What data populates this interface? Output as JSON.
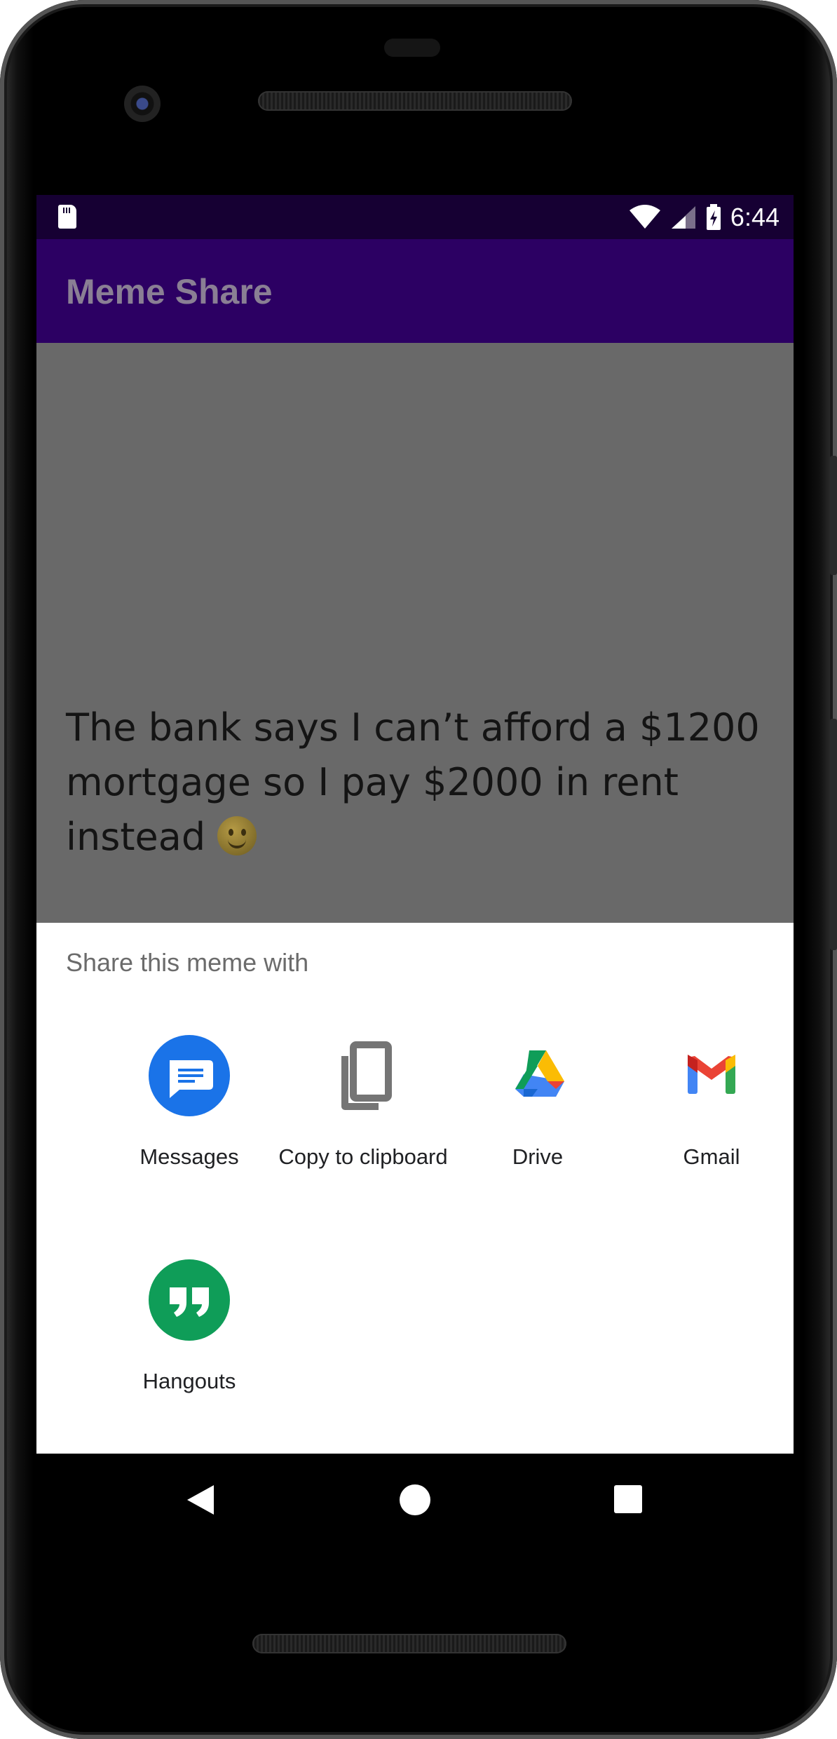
{
  "status_bar": {
    "time": "6:44"
  },
  "app_bar": {
    "title": "Meme Share"
  },
  "meme": {
    "text": "The bank says I can’t afford a $1200 mortgage so I pay $2000 in rent instead"
  },
  "share_sheet": {
    "title": "Share this meme with",
    "targets": [
      {
        "label": "Messages",
        "icon": "messages-icon"
      },
      {
        "label": "Copy to clipboard",
        "icon": "copy-icon"
      },
      {
        "label": "Drive",
        "icon": "drive-icon"
      },
      {
        "label": "Gmail",
        "icon": "gmail-icon"
      },
      {
        "label": "Hangouts",
        "icon": "hangouts-icon"
      }
    ]
  },
  "colors": {
    "status_bar": "#160033",
    "app_bar": "#2c0063",
    "scrim": "#696969",
    "sheet": "#ffffff"
  }
}
